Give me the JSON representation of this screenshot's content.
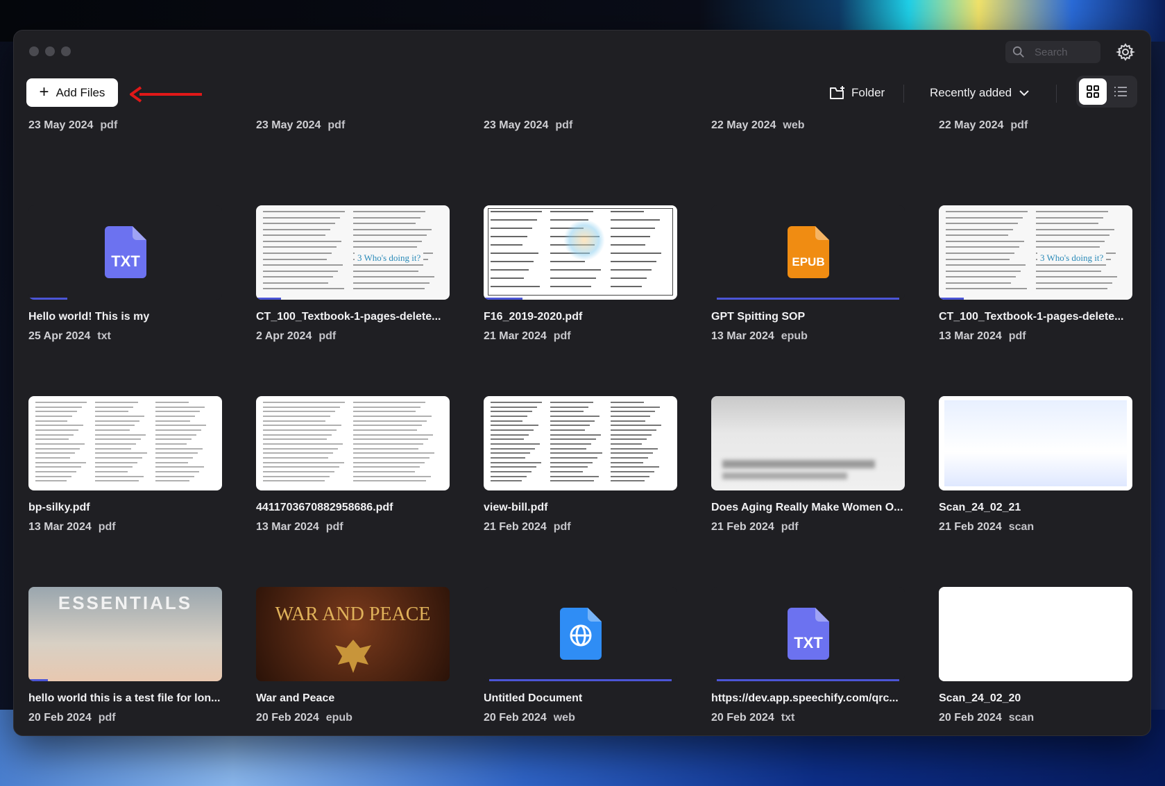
{
  "search": {
    "placeholder": "Search"
  },
  "toolbar": {
    "add_files_label": "Add Files",
    "folder_label": "Folder",
    "sort_label": "Recently added"
  },
  "top_row": [
    {
      "date": "23 May 2024",
      "ext": "pdf"
    },
    {
      "date": "23 May 2024",
      "ext": "pdf"
    },
    {
      "date": "23 May 2024",
      "ext": "pdf"
    },
    {
      "date": "22 May 2024",
      "ext": "web"
    },
    {
      "date": "22 May 2024",
      "ext": "pdf"
    }
  ],
  "items": [
    {
      "title": "Hello world! This is my",
      "date": "25 Apr 2024",
      "ext": "txt",
      "thumb": "txt-icon",
      "progress": 0.2
    },
    {
      "title": "CT_100_Textbook-1-pages-delete...",
      "date": "2 Apr 2024",
      "ext": "pdf",
      "thumb": "textbook",
      "progress": 0.13
    },
    {
      "title": "F16_2019-2020.pdf",
      "date": "21 Mar 2024",
      "ext": "pdf",
      "thumb": "form",
      "progress": 0.2
    },
    {
      "title": "GPT Spitting SOP",
      "date": "13 Mar 2024",
      "ext": "epub",
      "thumb": "epub-icon",
      "progress": 1.0
    },
    {
      "title": "CT_100_Textbook-1-pages-delete...",
      "date": "13 Mar 2024",
      "ext": "pdf",
      "thumb": "textbook",
      "progress": 0.13
    },
    {
      "title": "bp-silky.pdf",
      "date": "13 Mar 2024",
      "ext": "pdf",
      "thumb": "doc",
      "progress": 0
    },
    {
      "title": "4411703670882958686.pdf",
      "date": "13 Mar 2024",
      "ext": "pdf",
      "thumb": "doc",
      "progress": 0
    },
    {
      "title": "view-bill.pdf",
      "date": "21 Feb 2024",
      "ext": "pdf",
      "thumb": "bill",
      "progress": 0
    },
    {
      "title": "Does Aging Really Make Women O...",
      "date": "21 Feb 2024",
      "ext": "pdf",
      "thumb": "blur",
      "progress": 0
    },
    {
      "title": "Scan_24_02_21",
      "date": "21 Feb 2024",
      "ext": "scan",
      "thumb": "scan",
      "progress": 0
    },
    {
      "title": "hello world this is a test file for lon...",
      "date": "20 Feb 2024",
      "ext": "pdf",
      "thumb": "essentials",
      "progress": 0.1
    },
    {
      "title": "War and Peace",
      "date": "20 Feb 2024",
      "ext": "epub",
      "thumb": "warpeace",
      "progress": 0
    },
    {
      "title": "Untitled Document",
      "date": "20 Feb 2024",
      "ext": "web",
      "thumb": "web-icon",
      "progress": 1.0
    },
    {
      "title": "https://dev.app.speechify.com/qrc...",
      "date": "20 Feb 2024",
      "ext": "txt",
      "thumb": "txt-icon",
      "progress": 1.0
    },
    {
      "title": "Scan_24_02_20",
      "date": "20 Feb 2024",
      "ext": "scan",
      "thumb": "checklist",
      "progress": 0
    }
  ],
  "thumb_text": {
    "txt": "TXT",
    "epub": "EPUB",
    "essentials": "ESSENTIALS",
    "warpeace": "WAR AND PEACE",
    "whos_doing": "3 Who's doing it?"
  },
  "colors": {
    "accent": "#4b55d6",
    "txt_icon": "#6c72f0",
    "epub_icon": "#f08c12",
    "web_icon": "#2f8df5"
  }
}
